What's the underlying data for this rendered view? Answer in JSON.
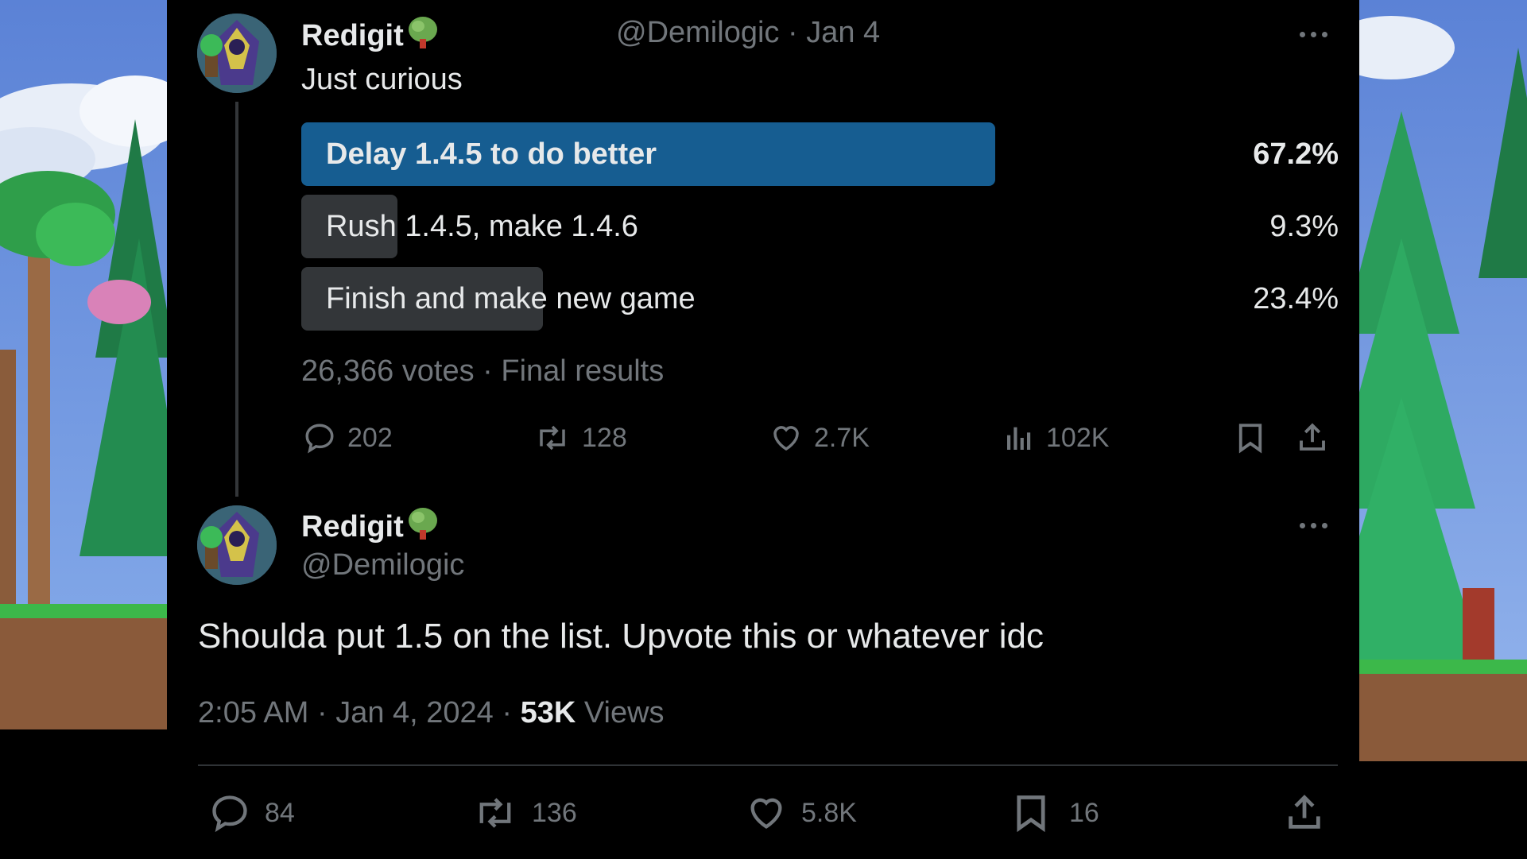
{
  "colors": {
    "accent": "#165d91",
    "text": "#e7e9ea",
    "muted": "#71767b",
    "bar": "#333639"
  },
  "main_tweet": {
    "author_name": "Redigit",
    "author_badge_icon": "tree-icon",
    "handle": "@Demilogic",
    "separator": "·",
    "date": "Jan 4",
    "text": "Just curious",
    "poll": {
      "options": [
        {
          "label": "Delay 1.4.5 to do better",
          "percent_label": "67.2%",
          "fraction": 0.672,
          "winner": true
        },
        {
          "label": "Rush 1.4.5, make 1.4.6",
          "percent_label": "9.3%",
          "fraction": 0.093,
          "winner": false
        },
        {
          "label": "Finish and make new game",
          "percent_label": "23.4%",
          "fraction": 0.234,
          "winner": false
        }
      ],
      "meta": "26,366 votes · Final results"
    },
    "actions": {
      "replies": "202",
      "reposts": "128",
      "likes": "2.7K",
      "views": "102K"
    }
  },
  "reply_tweet": {
    "author_name": "Redigit",
    "handle": "@Demilogic",
    "text": "Shoulda put 1.5 on the list. Upvote this or whatever idc",
    "time": "2:05 AM",
    "date": "Jan 4, 2024",
    "views_count": "53K",
    "views_label": "Views",
    "actions": {
      "replies": "84",
      "reposts": "136",
      "likes": "5.8K",
      "bookmarks": "16"
    }
  }
}
